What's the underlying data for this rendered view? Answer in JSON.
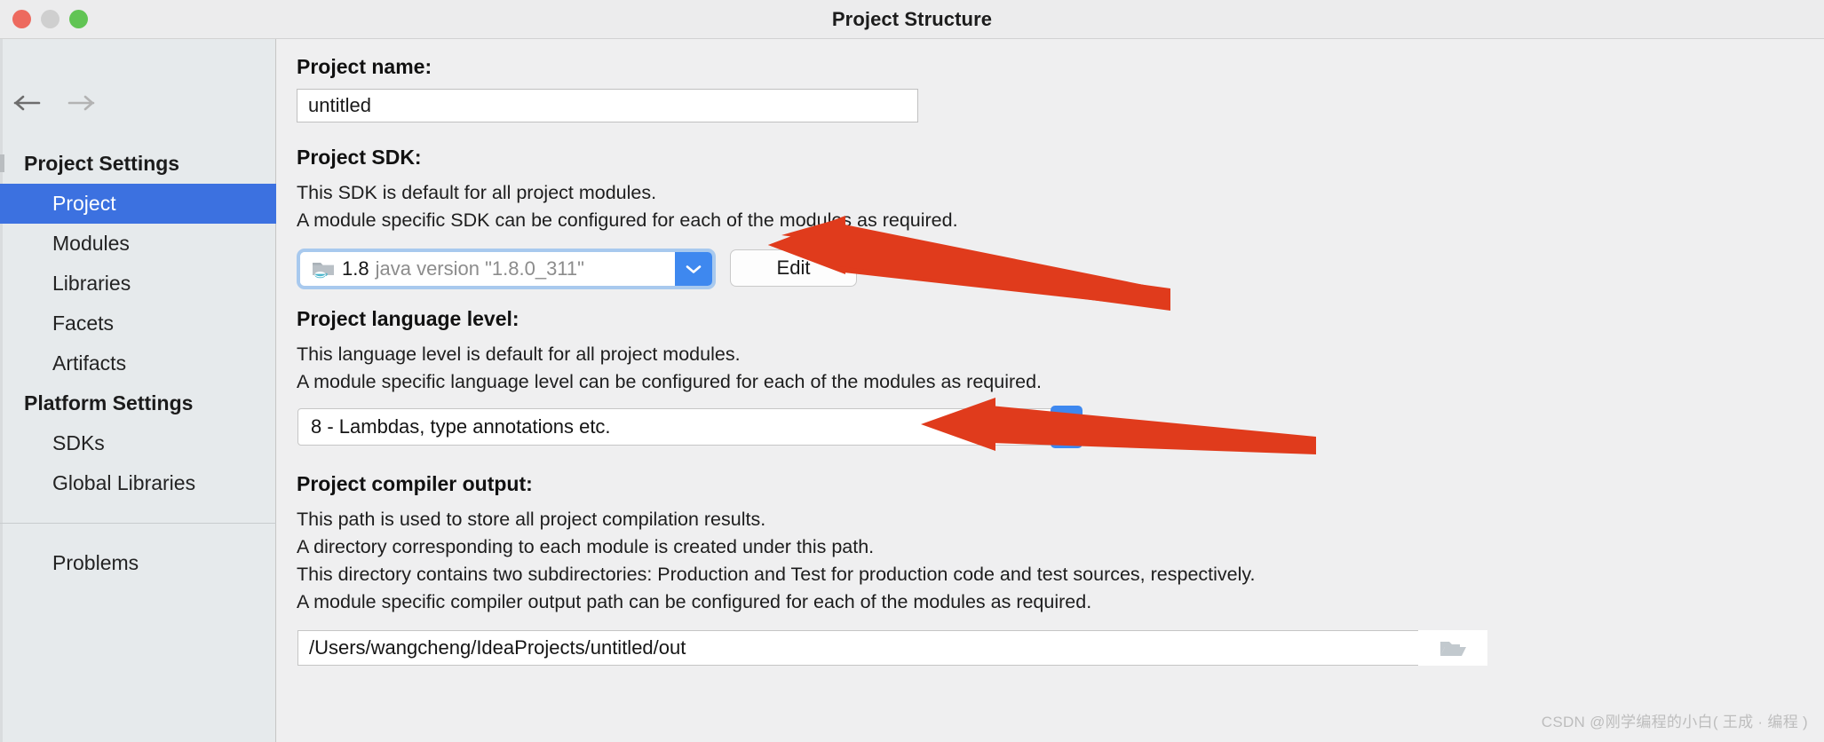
{
  "window": {
    "title": "Project Structure",
    "traffic_lights": [
      "close",
      "minimize",
      "maximize"
    ]
  },
  "sidebar": {
    "nav_back": "back-arrow",
    "nav_forward": "forward-arrow",
    "groups": [
      {
        "title": "Project Settings",
        "items": [
          {
            "label": "Project",
            "selected": true
          },
          {
            "label": "Modules",
            "selected": false
          },
          {
            "label": "Libraries",
            "selected": false
          },
          {
            "label": "Facets",
            "selected": false
          },
          {
            "label": "Artifacts",
            "selected": false
          }
        ]
      },
      {
        "title": "Platform Settings",
        "items": [
          {
            "label": "SDKs",
            "selected": false
          },
          {
            "label": "Global Libraries",
            "selected": false
          }
        ]
      }
    ],
    "problems": {
      "label": "Problems",
      "selected": false
    }
  },
  "main": {
    "project_name": {
      "label": "Project name:",
      "value": "untitled"
    },
    "project_sdk": {
      "label": "Project SDK:",
      "desc_line1": "This SDK is default for all project modules.",
      "desc_line2": "A module specific SDK can be configured for each of the modules as required.",
      "selected_version": "1.8",
      "selected_desc": "java version \"1.8.0_311\"",
      "edit_button": "Edit",
      "icon": "java-folder-icon"
    },
    "language_level": {
      "label": "Project language level:",
      "desc_line1": "This language level is default for all project modules.",
      "desc_line2": "A module specific language level can be configured for each of the modules as required.",
      "value": "8 - Lambdas, type annotations etc."
    },
    "compiler_output": {
      "label": "Project compiler output:",
      "desc_line1": "This path is used to store all project compilation results.",
      "desc_line2": "A directory corresponding to each module is created under this path.",
      "desc_line3": "This directory contains two subdirectories: Production and Test for production code and test sources, respectively.",
      "desc_line4": "A module specific compiler output path can be configured for each of the modules as required.",
      "value": "/Users/wangcheng/IdeaProjects/untitled/out",
      "browse_icon": "folder-icon"
    }
  },
  "annotations": {
    "arrow_color": "#e03b1c",
    "arrow_sdk": "points-to-sdk-dropdown",
    "arrow_language_level": "points-to-language-level-dropdown"
  },
  "watermark": {
    "text": "CSDN @刚学编程的小白( 王成 · 编程 )"
  },
  "colors": {
    "accent_selected": "#3c71e0",
    "combo_button": "#3e88ef",
    "annotation_red": "#e03b1c",
    "sidebar_bg": "#e6eaec",
    "content_bg": "#efeff0"
  }
}
